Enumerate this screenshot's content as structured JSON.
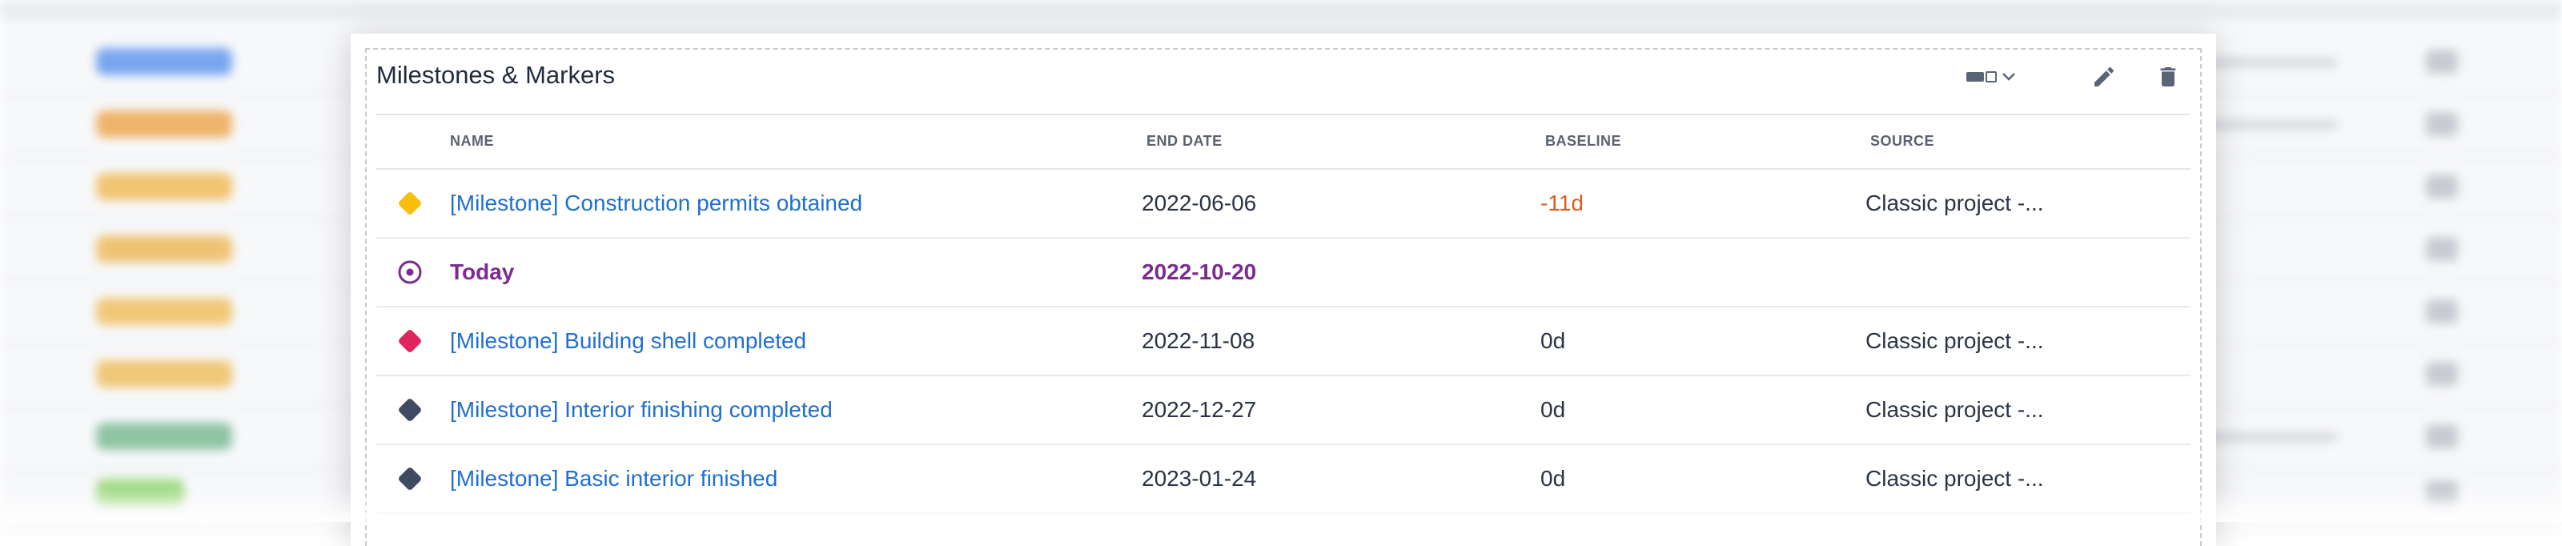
{
  "panel": {
    "title": "Milestones & Markers",
    "toolbar": {
      "view_toggle_icon": "layout-toggle-icon",
      "edit_icon": "pencil-icon",
      "delete_icon": "trash-icon"
    }
  },
  "table": {
    "columns": {
      "name": "NAME",
      "end_date": "END DATE",
      "baseline": "BASELINE",
      "source": "SOURCE"
    },
    "rows": [
      {
        "icon": "diamond-icon",
        "icon_color": "#F5BF0C",
        "name": "[Milestone] Construction permits obtained",
        "end_date": "2022-06-06",
        "baseline": "-11d",
        "source": "Classic project -..."
      },
      {
        "icon": "today-target-icon",
        "icon_color": "#7A2C8F",
        "name": "Today",
        "end_date": "2022-10-20",
        "baseline": "",
        "source": ""
      },
      {
        "icon": "diamond-icon",
        "icon_color": "#E0245E",
        "name": "[Milestone] Building shell completed",
        "end_date": "2022-11-08",
        "baseline": "0d",
        "source": "Classic project -..."
      },
      {
        "icon": "diamond-icon",
        "icon_color": "#3F4B63",
        "name": "[Milestone] Interior finishing completed",
        "end_date": "2022-12-27",
        "baseline": "0d",
        "source": "Classic project -..."
      },
      {
        "icon": "diamond-icon",
        "icon_color": "#3F4B63",
        "name": "[Milestone] Basic interior finished",
        "end_date": "2023-01-24",
        "baseline": "0d",
        "source": "Classic project -..."
      }
    ]
  },
  "colors": {
    "link": "#1F6FD1",
    "today": "#7A2C8F",
    "negative_baseline": "#E05A1C"
  }
}
